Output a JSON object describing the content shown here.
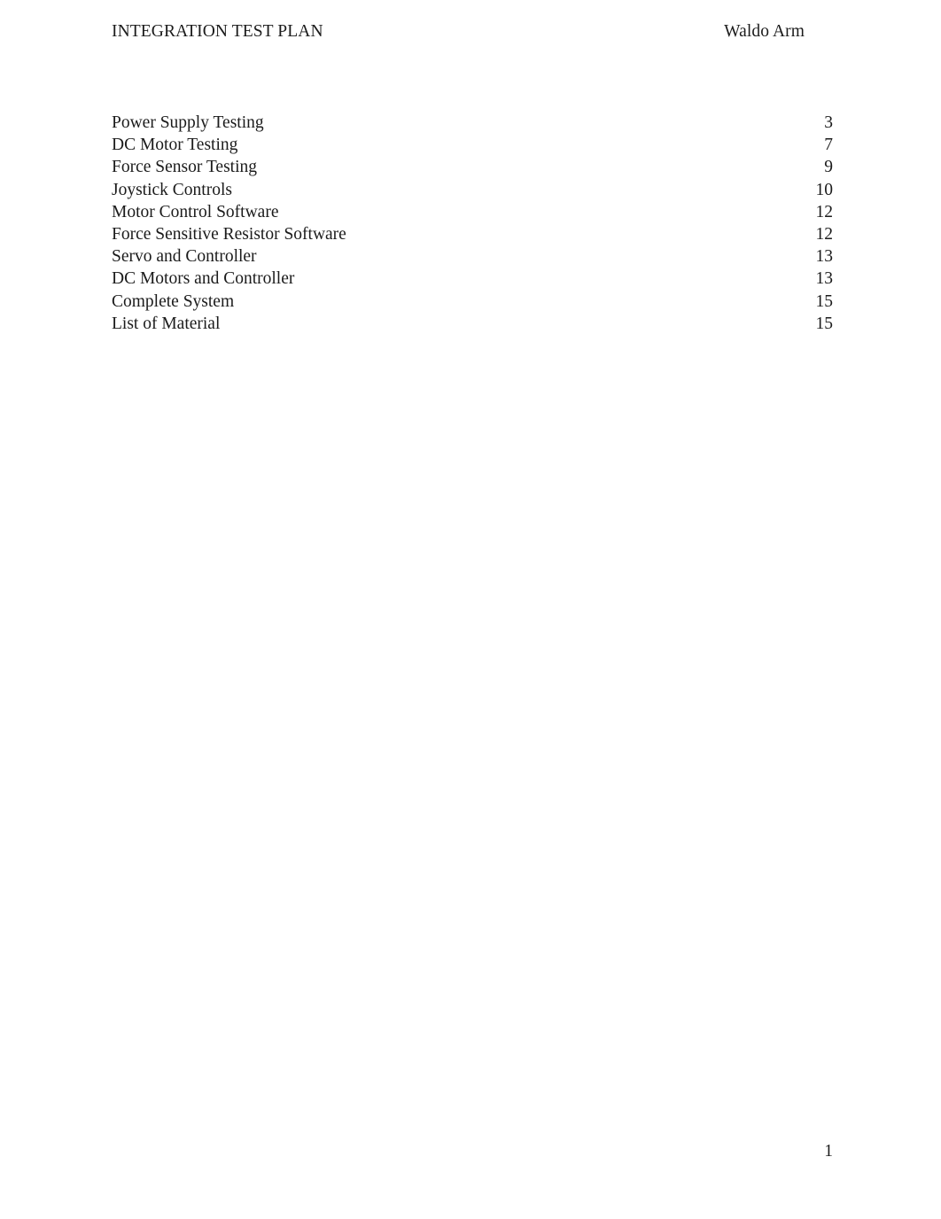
{
  "document": {
    "header": {
      "left_title": "INTEGRATION TEST PLAN",
      "right_title": "Waldo Arm"
    },
    "toc": {
      "entries": [
        {
          "title": "Power Supply Testing",
          "page": "3"
        },
        {
          "title": "DC Motor Testing",
          "page": "7"
        },
        {
          "title": "Force Sensor Testing",
          "page": "9"
        },
        {
          "title": "Joystick Controls",
          "page": "10"
        },
        {
          "title": "Motor Control Software",
          "page": "12"
        },
        {
          "title": "Force Sensitive Resistor Software",
          "page": "12"
        },
        {
          "title": "Servo and Controller",
          "page": "13"
        },
        {
          "title": "DC Motors and Controller",
          "page": "13"
        },
        {
          "title": "Complete System",
          "page": "15"
        },
        {
          "title": "List of Material",
          "page": "15"
        }
      ]
    },
    "footer": {
      "page_number": "1"
    },
    "colors": {
      "page_background": "#ffffff",
      "text": "#1b1b1b"
    }
  }
}
